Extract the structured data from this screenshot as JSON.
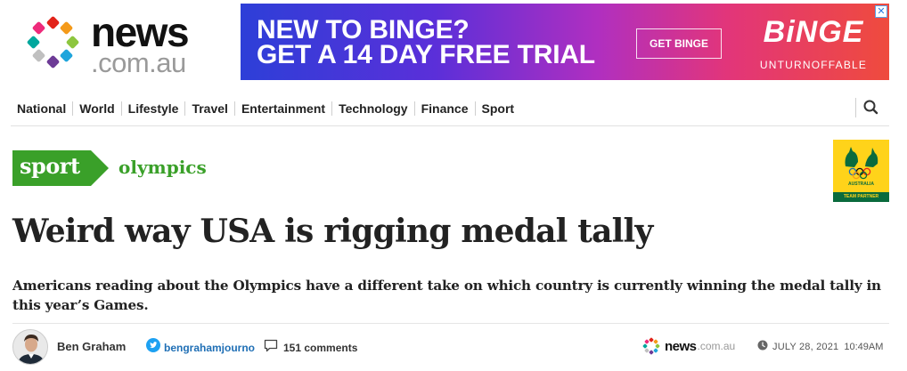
{
  "brand": {
    "word": "news",
    "domain": ".com.au",
    "dot_colors": [
      "#e2231a",
      "#f49a1a",
      "#8dc63f",
      "#1fa5dc",
      "#6d3b96",
      "#c0c0c0",
      "#00a79d",
      "#ee2a7b"
    ]
  },
  "ad": {
    "line1": "NEW TO BINGE?",
    "line2": "GET A 14 DAY FREE TRIAL",
    "cta": "GET BINGE",
    "brand": "BiNGE",
    "tagline": "UNTURNOFFABLE"
  },
  "nav": {
    "items": [
      "National",
      "World",
      "Lifestyle",
      "Travel",
      "Entertainment",
      "Technology",
      "Finance",
      "Sport"
    ],
    "search_icon": "search-icon"
  },
  "section": {
    "tag": "sport",
    "subtag": "olympics",
    "color": "#3aa029"
  },
  "partner": {
    "label": "AUSTRALIA",
    "foot": "TEAM PARTNER"
  },
  "article": {
    "headline": "Weird way USA is rigging medal tally",
    "standfirst": "Americans reading about the Olympics have a different take on which country is currently winning the medal tally in this year’s Games."
  },
  "byline": {
    "author": "Ben Graham",
    "twitter": "bengrahamjourno",
    "comments": "151 comments",
    "source_word": "news",
    "source_domain": ".com.au",
    "date": "JULY 28, 2021",
    "time": "10:49AM"
  }
}
